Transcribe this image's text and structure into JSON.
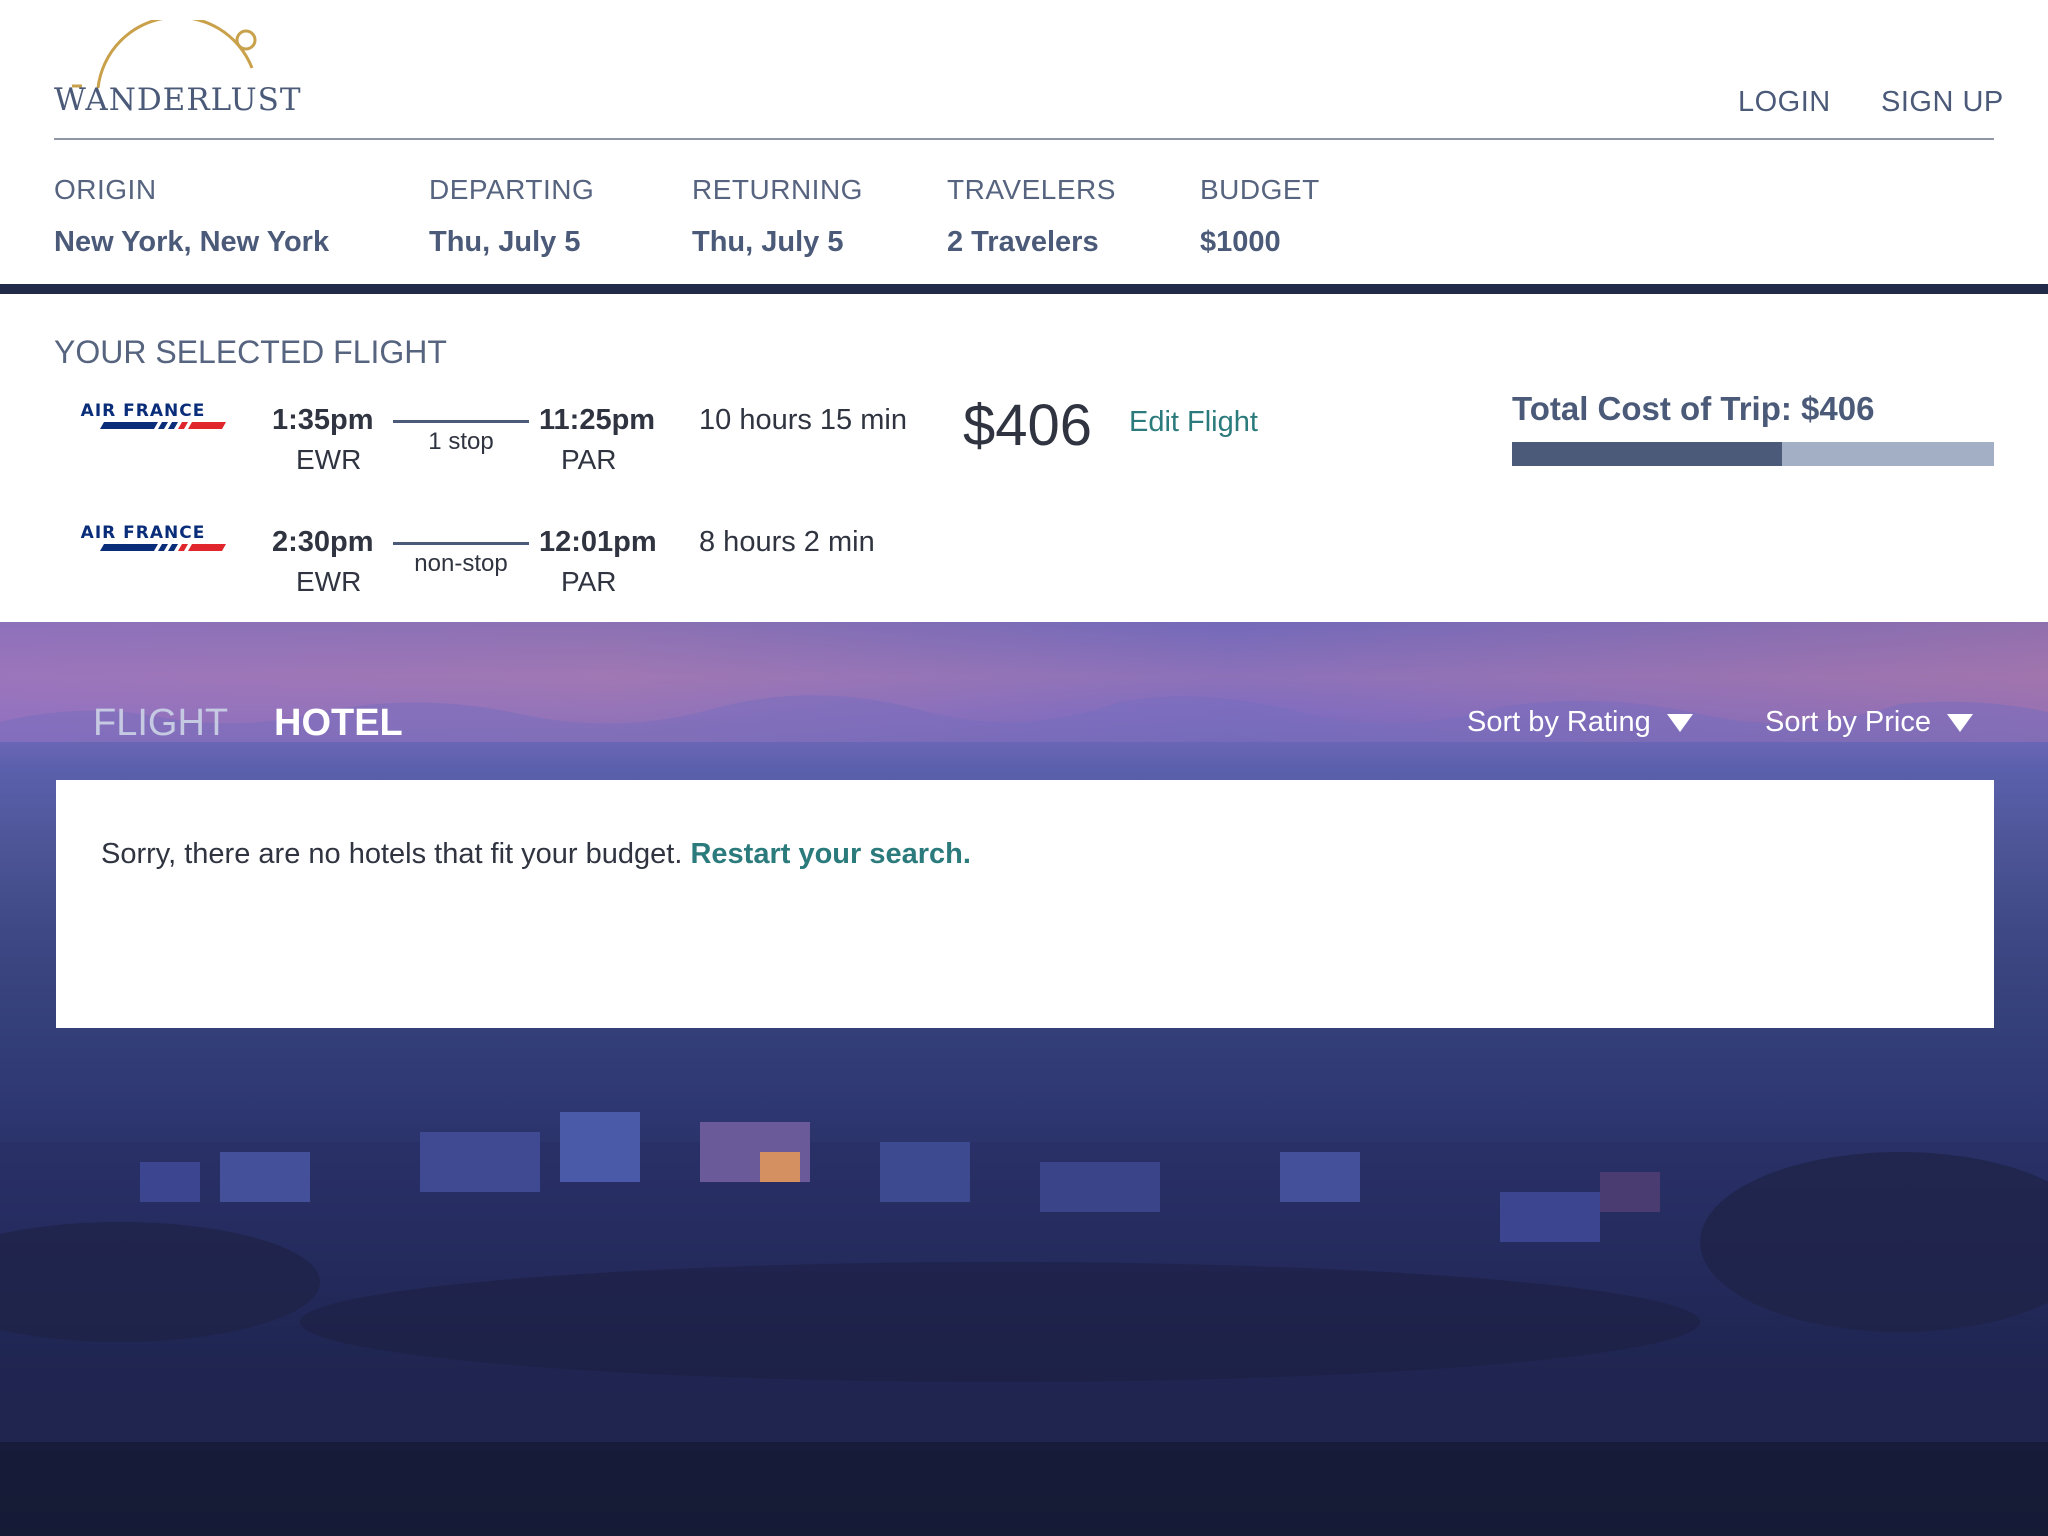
{
  "header": {
    "brand": "WANDERLUST",
    "login_label": "LOGIN",
    "signup_label": "SIGN UP"
  },
  "search": {
    "origin": {
      "label": "ORIGIN",
      "value": "New York, New York"
    },
    "departing": {
      "label": "DEPARTING",
      "value": "Thu, July 5"
    },
    "returning": {
      "label": "RETURNING",
      "value": "Thu, July 5"
    },
    "travelers": {
      "label": "TRAVELERS",
      "value": "2 Travelers"
    },
    "budget": {
      "label": "BUDGET",
      "value": "$1000"
    }
  },
  "selected_flight": {
    "title": "YOUR SELECTED FLIGHT",
    "airline": "AIR FRANCE",
    "outbound": {
      "depart_time": "1:35pm",
      "depart_code": "EWR",
      "stops": "1 stop",
      "arrive_time": "11:25pm",
      "arrive_code": "PAR",
      "duration": "10 hours 15 min"
    },
    "inbound": {
      "depart_time": "2:30pm",
      "depart_code": "EWR",
      "stops": "non-stop",
      "arrive_time": "12:01pm",
      "arrive_code": "PAR",
      "duration": "8 hours 2 min"
    },
    "price": "$406",
    "edit_label": "Edit Flight",
    "total_cost": "Total Cost of Trip: $406",
    "budget_used_fraction": 0.56
  },
  "tabs": {
    "flight": "FLIGHT",
    "hotel": "HOTEL",
    "active": "hotel"
  },
  "sort": {
    "rating": "Sort by Rating",
    "price": "Sort by Price"
  },
  "results": {
    "message": "Sorry, there are no hotels that fit your budget. ",
    "restart_link": "Restart your search."
  },
  "colors": {
    "brand_slate": "#4b5a78",
    "link_teal": "#2b7a7c",
    "logo_gold": "#c9a14a",
    "airline_blue": "#0a2d7a",
    "airline_red": "#e0262c"
  }
}
